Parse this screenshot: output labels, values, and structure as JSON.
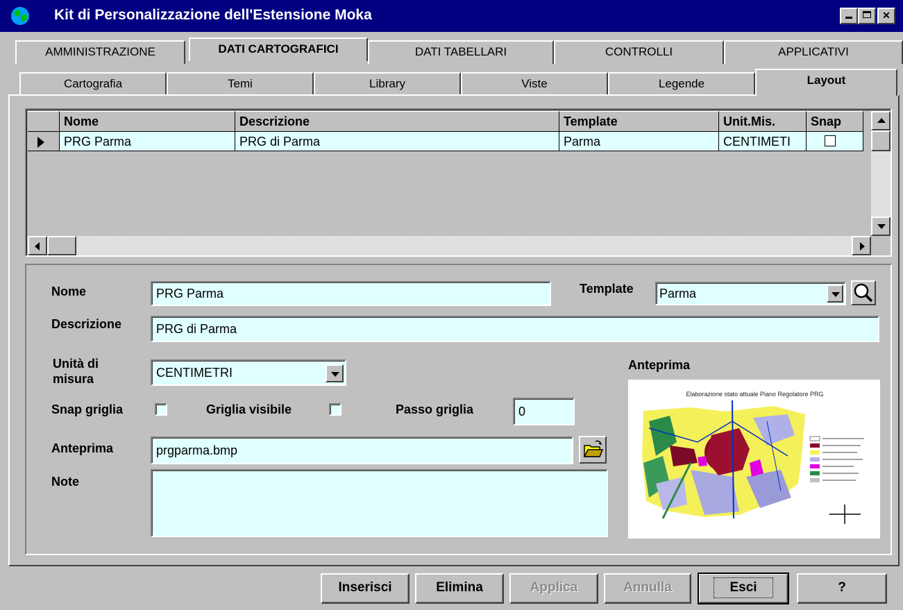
{
  "window": {
    "title": "Kit di Personalizzazione dell'Estensione Moka",
    "app_icon": "globe-icon"
  },
  "main_tabs": [
    {
      "label": "AMMINISTRAZIONE",
      "active": false
    },
    {
      "label": "DATI CARTOGRAFICI",
      "active": true
    },
    {
      "label": "DATI TABELLARI",
      "active": false
    },
    {
      "label": "CONTROLLI",
      "active": false
    },
    {
      "label": "APPLICATIVI",
      "active": false
    }
  ],
  "sub_tabs": [
    {
      "label": "Cartografia",
      "active": false
    },
    {
      "label": "Temi",
      "active": false
    },
    {
      "label": "Library",
      "active": false
    },
    {
      "label": "Viste",
      "active": false
    },
    {
      "label": "Legende",
      "active": false
    },
    {
      "label": "Layout",
      "active": true
    }
  ],
  "grid": {
    "columns": [
      "Nome",
      "Descrizione",
      "Template",
      "Unit.Mis.",
      "Snap"
    ],
    "rows": [
      {
        "nome": "PRG Parma",
        "descrizione": "PRG di Parma",
        "template": "Parma",
        "unit": "CENTIMETI",
        "snap": false
      }
    ]
  },
  "form": {
    "nome_label": "Nome",
    "nome_value": "PRG Parma",
    "template_label": "Template",
    "template_value": "Parma",
    "descrizione_label": "Descrizione",
    "descrizione_value": "PRG di Parma",
    "unita_label_1": "Unità di",
    "unita_label_2": "misura",
    "unita_value": "CENTIMETRI",
    "snap_label": "Snap griglia",
    "griglia_label": "Griglia visibile",
    "passo_label": "Passo griglia",
    "passo_value": "0",
    "anteprima_label": "Anteprima",
    "anteprima_value": "prgparma.bmp",
    "note_label": "Note",
    "note_value": "",
    "preview_label": "Anteprima",
    "preview_caption": "Elaborazione stato attuale Piano Regolatore PRG"
  },
  "buttons": [
    {
      "label": "Inserisci",
      "enabled": true
    },
    {
      "label": "Elimina",
      "enabled": true
    },
    {
      "label": "Applica",
      "enabled": false
    },
    {
      "label": "Annulla",
      "enabled": false
    },
    {
      "label": "Esci",
      "enabled": true
    },
    {
      "label": "?",
      "enabled": true
    }
  ],
  "colors": {
    "titlebar": "#000080",
    "field": "#e0ffff",
    "face": "#c0c0c0"
  }
}
